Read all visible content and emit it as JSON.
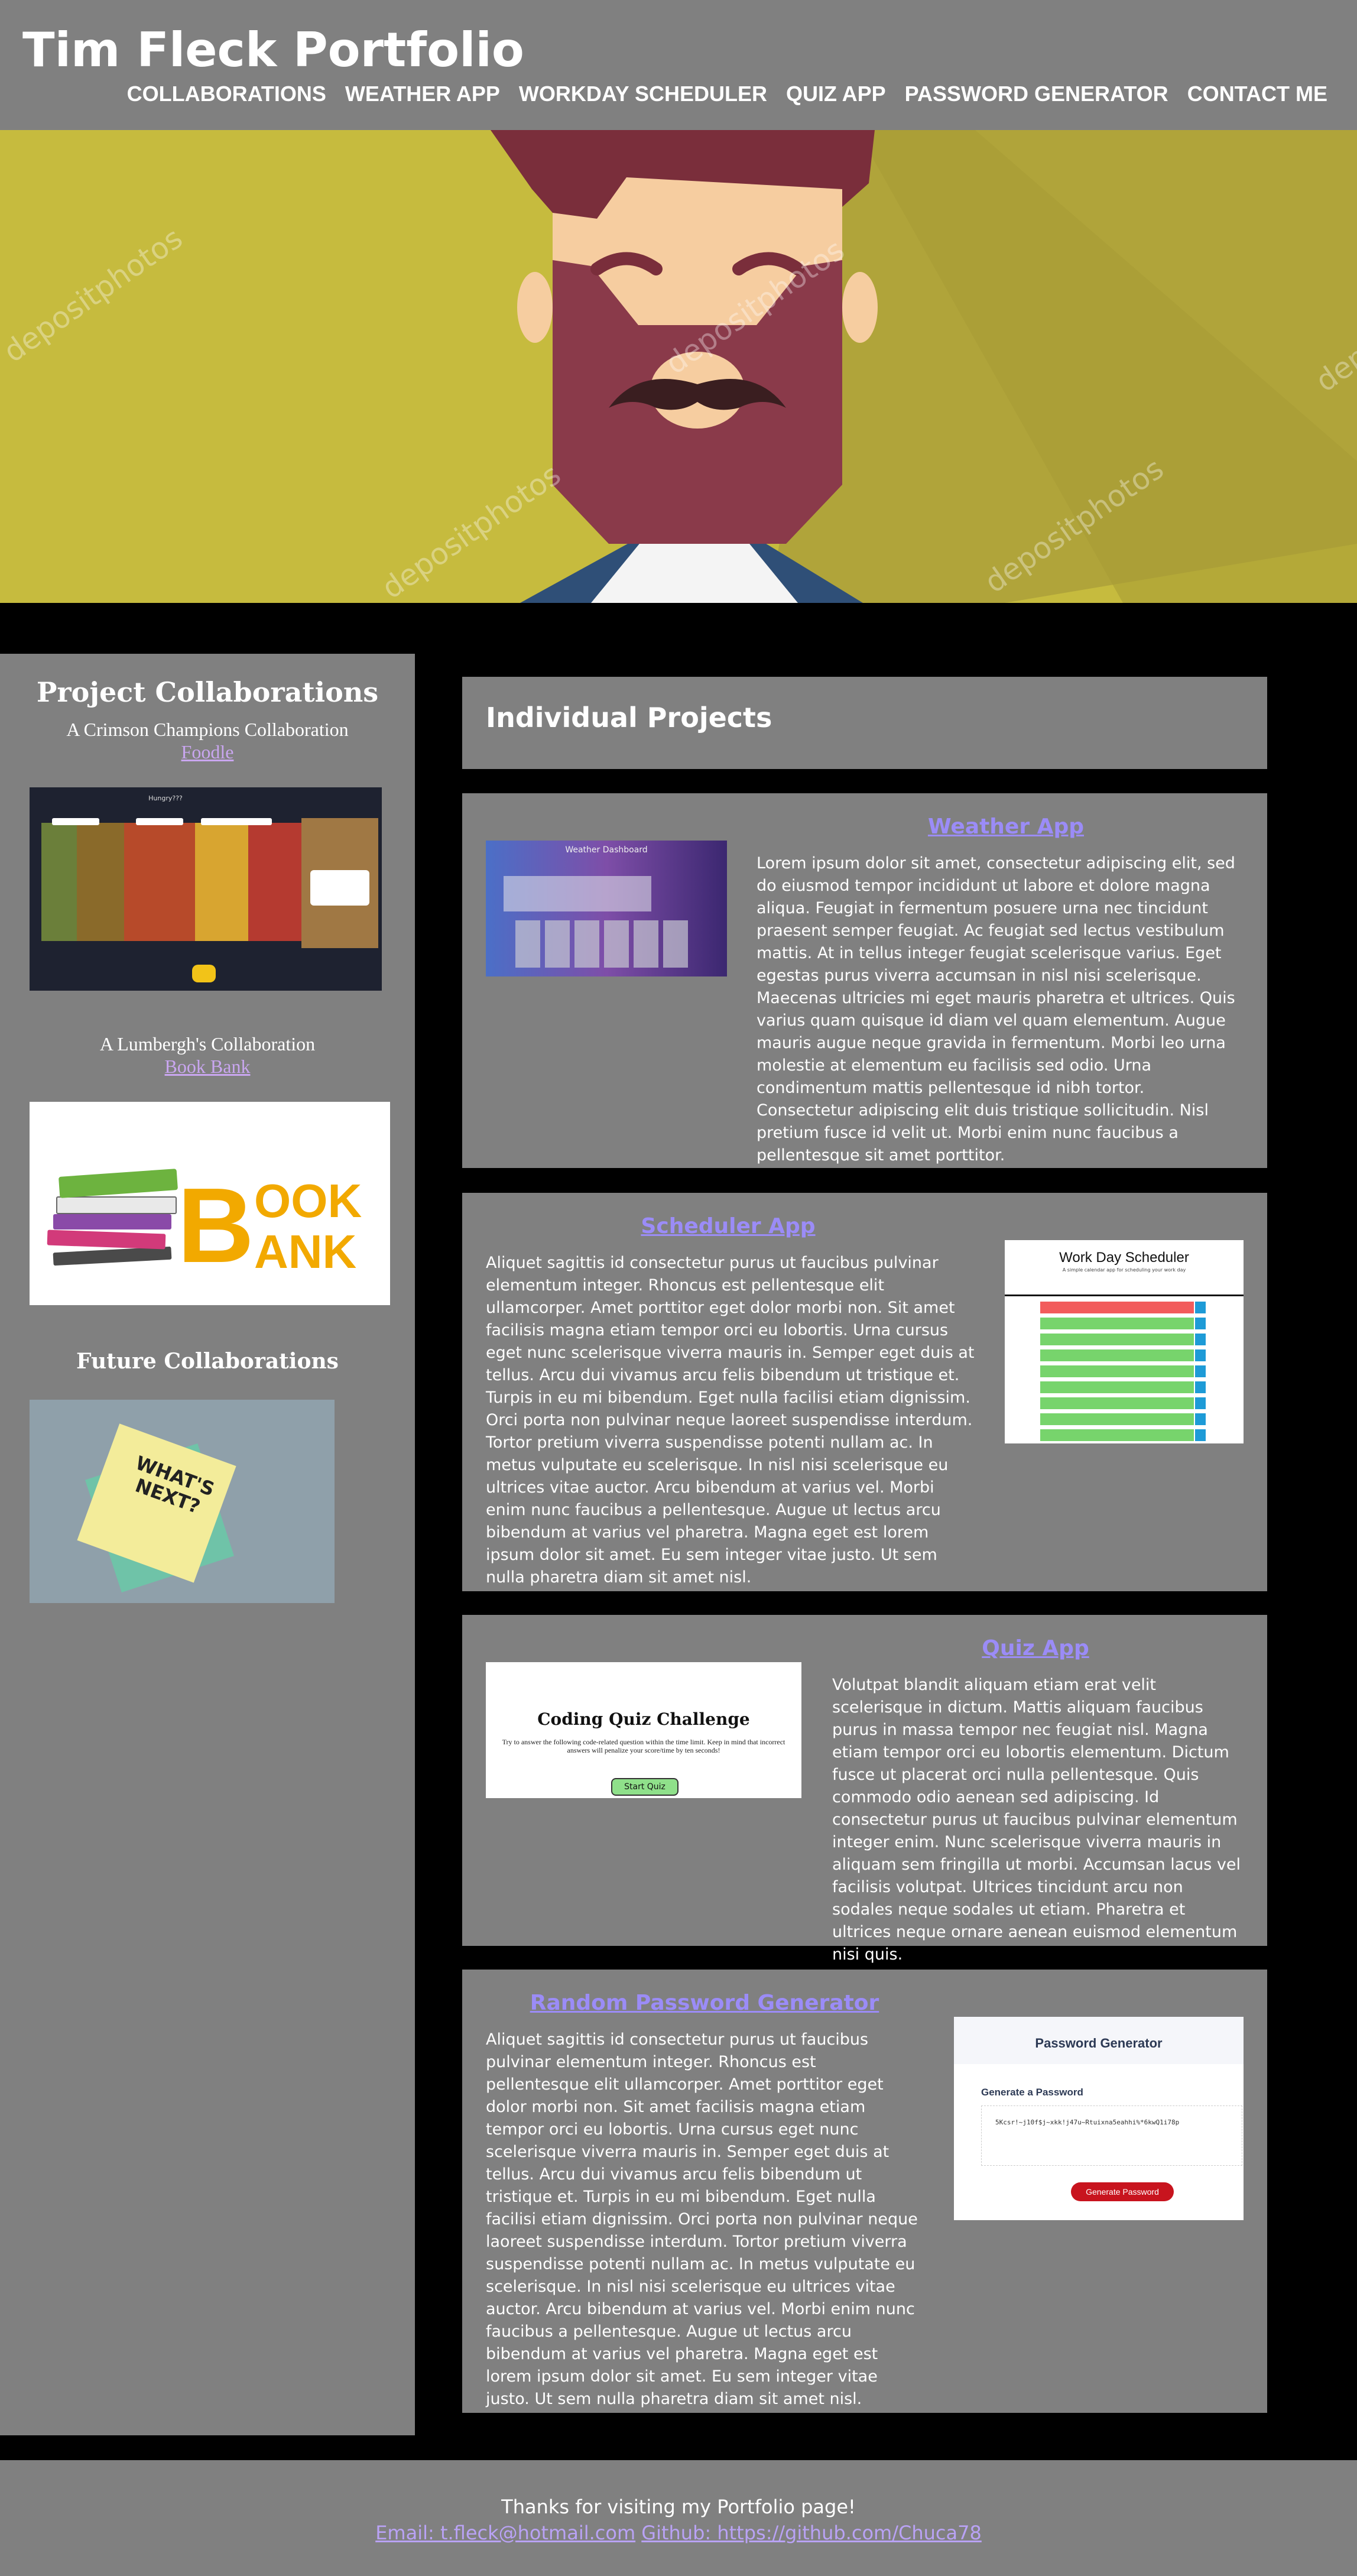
{
  "header": {
    "title": "Tim Fleck Portfolio",
    "nav": [
      "COLLABORATIONS",
      "WEATHER APP",
      "WORKDAY SCHEDULER",
      "QUIZ APP",
      "PASSWORD GENERATOR",
      "CONTACT ME"
    ]
  },
  "hero": {
    "watermark": "depositphotos",
    "colors": {
      "background": "#c6bb3e",
      "skin": "#f6cda0",
      "beard": "#8a3a4a",
      "hair": "#7a2e3b",
      "mustache": "#3a1e20"
    }
  },
  "sidebar": {
    "heading": "Project Collaborations",
    "collab1": {
      "subtitle": "A Crimson Champions Collaboration",
      "link": "Foodle",
      "thumb_title": "Hungry???"
    },
    "collab2": {
      "subtitle": "A Lumbergh's Collaboration",
      "link": "Book Bank",
      "logo_b": "B",
      "logo_ook": "OOK",
      "logo_ank": "ANK"
    },
    "future_heading": "Future Collaborations",
    "future_note": "WHAT'S NEXT?"
  },
  "main": {
    "title": "Individual Projects",
    "weather": {
      "title": "Weather App",
      "thumb_title": "Weather Dashboard",
      "text": "Lorem ipsum dolor sit amet, consectetur adipiscing elit, sed do eiusmod tempor incididunt ut labore et dolore magna aliqua. Feugiat in fermentum posuere urna nec tincidunt praesent semper feugiat. Ac feugiat sed lectus vestibulum mattis. At in tellus integer feugiat scelerisque varius. Eget egestas purus viverra accumsan in nisl nisi scelerisque. Maecenas ultricies mi eget mauris pharetra et ultrices. Quis varius quam quisque id diam vel quam elementum. Augue mauris augue neque gravida in fermentum. Morbi leo urna molestie at elementum eu facilisis sed odio. Urna condimentum mattis pellentesque id nibh tortor. Consectetur adipiscing elit duis tristique sollicitudin. Nisl pretium fusce id velit ut. Morbi enim nunc faucibus a pellentesque sit amet porttitor."
    },
    "scheduler": {
      "title": "Scheduler App",
      "thumb_title": "Work Day Scheduler",
      "thumb_sub": "A simple calendar app for scheduling your work day",
      "text": "Aliquet sagittis id consectetur purus ut faucibus pulvinar elementum integer. Rhoncus est pellentesque elit ullamcorper. Amet porttitor eget dolor morbi non. Sit amet facilisis magna etiam tempor orci eu lobortis. Urna cursus eget nunc scelerisque viverra mauris in. Semper eget duis at tellus. Arcu dui vivamus arcu felis bibendum ut tristique et. Turpis in eu mi bibendum. Eget nulla facilisi etiam dignissim. Orci porta non pulvinar neque laoreet suspendisse interdum. Tortor pretium viverra suspendisse potenti nullam ac. In metus vulputate eu scelerisque. In nisl nisi scelerisque eu ultrices vitae auctor. Arcu bibendum at varius vel. Morbi enim nunc faucibus a pellentesque. Augue ut lectus arcu bibendum at varius vel pharetra. Magna eget est lorem ipsum dolor sit amet. Eu sem integer vitae justo. Ut sem nulla pharetra diam sit amet nisl."
    },
    "quiz": {
      "title": "Quiz App",
      "thumb_title": "Coding Quiz Challenge",
      "thumb_text": "Try to answer the following code-related question within the time limit. Keep in mind that incorrect answers will penalize your score/time by ten seconds!",
      "thumb_button": "Start Quiz",
      "text": "Volutpat blandit aliquam etiam erat velit scelerisque in dictum. Mattis aliquam faucibus purus in massa tempor nec feugiat nisl. Magna etiam tempor orci eu lobortis elementum. Dictum fusce ut placerat orci nulla pellentesque. Quis commodo odio aenean sed adipiscing. Id consectetur purus ut faucibus pulvinar elementum integer enim. Nunc scelerisque viverra mauris in aliquam sem fringilla ut morbi. Accumsan lacus vel facilisis volutpat. Ultrices tincidunt arcu non sodales neque sodales ut etiam. Pharetra et ultrices neque ornare aenean euismod elementum nisi quis."
    },
    "password": {
      "title": "Random Password Generator",
      "thumb_title": "Password Generator",
      "thumb_sub": "Generate a Password",
      "thumb_output": "5Kcsr!~j10f$j~xkk!j47u~Rtuixna5eahhi%*6kwQ1i78p",
      "thumb_button": "Generate Password",
      "text": "Aliquet sagittis id consectetur purus ut faucibus pulvinar elementum integer. Rhoncus est pellentesque elit ullamcorper. Amet porttitor eget dolor morbi non. Sit amet facilisis magna etiam tempor orci eu lobortis. Urna cursus eget nunc scelerisque viverra mauris in. Semper eget duis at tellus. Arcu dui vivamus arcu felis bibendum ut tristique et. Turpis in eu mi bibendum. Eget nulla facilisi etiam dignissim. Orci porta non pulvinar neque laoreet suspendisse interdum. Tortor pretium viverra suspendisse potenti nullam ac. In metus vulputate eu scelerisque. In nisl nisi scelerisque eu ultrices vitae auctor. Arcu bibendum at varius vel. Morbi enim nunc faucibus a pellentesque. Augue ut lectus arcu bibendum at varius vel pharetra. Magna eget est lorem ipsum dolor sit amet. Eu sem integer vitae justo. Ut sem nulla pharetra diam sit amet nisl."
    }
  },
  "footer": {
    "thanks": "Thanks for visiting my Portfolio page!",
    "email": "Email: t.fleck@hotmail.com",
    "github": "Github: https://github.com/Chuca78"
  },
  "colors": {
    "panel": "#808080",
    "background": "#000000",
    "link": "#9b8cf7"
  }
}
